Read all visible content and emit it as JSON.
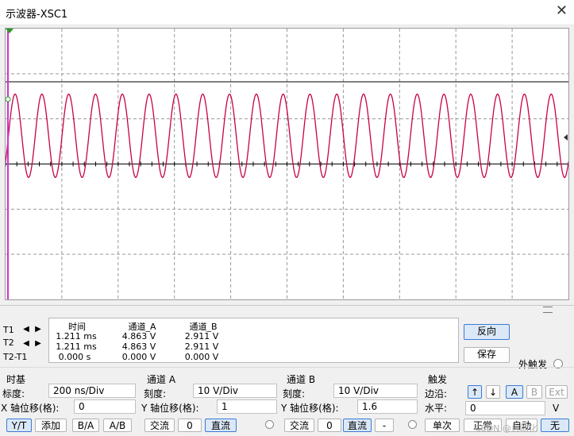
{
  "window": {
    "title": "示波器-XSC1",
    "close": "✕"
  },
  "measurements": {
    "row_labels": [
      "T1",
      "T2",
      "T2-T1"
    ],
    "headers": [
      "时间",
      "通道_A",
      "通道_B"
    ],
    "rows": [
      [
        "1.211 ms",
        "4.863 V",
        "2.911 V"
      ],
      [
        "1.211 ms",
        "4.863 V",
        "2.911 V"
      ],
      [
        "0.000 s",
        "0.000 V",
        "0.000 V"
      ]
    ]
  },
  "right_panel": {
    "reverse": "反向",
    "save": "保存",
    "ext_trigger": "外触发"
  },
  "timebase": {
    "title": "时基",
    "scale_label": "标度:",
    "scale_value": "200 ns/Div",
    "xpos_label": "X 轴位移(格):",
    "xpos_value": "0",
    "modes": [
      "Y/T",
      "添加",
      "B/A",
      "A/B"
    ],
    "selected_mode": "Y/T"
  },
  "channel_a": {
    "title": "通道 A",
    "scale_label": "刻度:",
    "scale_value": "10  V/Div",
    "ypos_label": "Y 轴位移(格):",
    "ypos_value": "1",
    "coupling": [
      "交流",
      "0",
      "直流"
    ],
    "selected": "直流"
  },
  "channel_b": {
    "title": "通道 B",
    "scale_label": "刻度:",
    "scale_value": "10  V/Div",
    "ypos_label": "Y 轴位移(格):",
    "ypos_value": "1.6",
    "coupling": [
      "交流",
      "0",
      "直流",
      "-"
    ],
    "selected": "直流"
  },
  "trigger": {
    "title": "触发",
    "edge_label": "边沿:",
    "edge_rise": "↑",
    "edge_fall": "↓",
    "sources": [
      "A",
      "B",
      "Ext"
    ],
    "selected_source": "A",
    "level_label": "水平:",
    "level_value": "0",
    "level_unit": "V",
    "modes": [
      "单次",
      "正常",
      "自动",
      "无"
    ]
  },
  "watermark": "CSDN @自动化",
  "trace": {
    "color": "#c8004a",
    "cursor_color": "#cc33cc",
    "periods_visible": 21,
    "peak_div": 1.55,
    "trough_div": -0.3
  }
}
